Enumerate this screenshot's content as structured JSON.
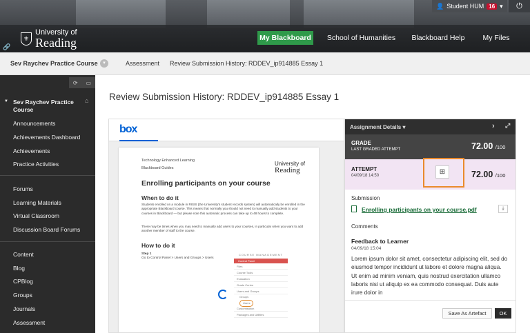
{
  "header": {
    "logo_line1": "University of",
    "logo_line2": "Reading",
    "user_name": "Student HUM",
    "notification_count": "16",
    "nav_tabs": [
      "My Blackboard",
      "School of Humanities",
      "Blackboard Help",
      "My Files"
    ]
  },
  "breadcrumb": {
    "course": "Sev Raychev Practice Course",
    "items": [
      "Assessment",
      "Review Submission History: RDDEV_ip914885 Essay 1"
    ]
  },
  "sidebar": {
    "course_title": "Sev Raychev Practice Course",
    "group1": [
      "Announcements",
      "Achievements Dashboard",
      "Achievements",
      "Practice Activities"
    ],
    "group2": [
      "Forums",
      "Learning Materials",
      "Virtual Classroom",
      "Discussion Board Forums"
    ],
    "group3": [
      "Content",
      "Blog",
      "CPBlog",
      "Groups",
      "Journals",
      "Assessment"
    ]
  },
  "page_title": "Review Submission History: RDDEV_ip914885 Essay 1",
  "viewer": {
    "brand": "box",
    "doc": {
      "header1": "Technology Enhanced Learning",
      "header2": "Blackboard Guides",
      "logo_line1": "University of",
      "logo_line2": "Reading",
      "title": "Enrolling participants on your course",
      "section1": "When to do it",
      "para1": "Students enrolled on a module in RISIS (the University's student records system) will automatically be enrolled in the appropriate Blackboard course. This means that normally you should not need to manually add students to your courses in Blackboard — but please note this automatic process can take up to 48 hours to complete.",
      "para2": "There may be times when you may need to manually add users to your courses, in particular when you want to add another member of staff to the course.",
      "section2": "How to do it",
      "step_label": "Step 1",
      "step_text": "Go to Control Panel > Users and Groups > Users",
      "menu_header": "COURSE MANAGEMENT",
      "menu_items": [
        "Control Panel",
        "Files",
        "Course Tools",
        "Evaluation",
        "Grade Centre",
        "Users and Groups"
      ],
      "menu_sub": [
        "Groups",
        "Users"
      ],
      "menu_items2": [
        "Customisation",
        "Packages and Utilities"
      ]
    }
  },
  "panel": {
    "title": "Assignment Details",
    "grade_label": "GRADE",
    "grade_sub": "LAST GRADED ATTEMPT",
    "grade_score": "72.00",
    "grade_max": "/100",
    "attempt_label": "ATTEMPT",
    "attempt_date": "04/09/18 14:50",
    "attempt_score": "72.00",
    "attempt_max": "/100",
    "submission_label": "Submission",
    "file_name": "Enrolling participants on your course.pdf",
    "comments_label": "Comments",
    "feedback_title": "Feedback to Learner",
    "feedback_date": "04/09/18 15:04",
    "feedback_body": "Lorem ipsum dolor sit amet, consectetur adipiscing elit, sed do eiusmod tempor incididunt ut labore et dolore magna aliqua. Ut enim ad minim veniam, quis nostrud exercitation ullamco laboris nisi ut aliquip ex ea commodo consequat. Duis aute irure dolor in",
    "save_artefact": "Save As Artefact",
    "ok": "OK"
  },
  "colors": {
    "active_tab": "#2f9a4a",
    "attempt_bg": "#f2e4f3",
    "highlight": "#ea8a2b",
    "box_blue": "#0061d5",
    "file_link": "#1c6d3a"
  }
}
